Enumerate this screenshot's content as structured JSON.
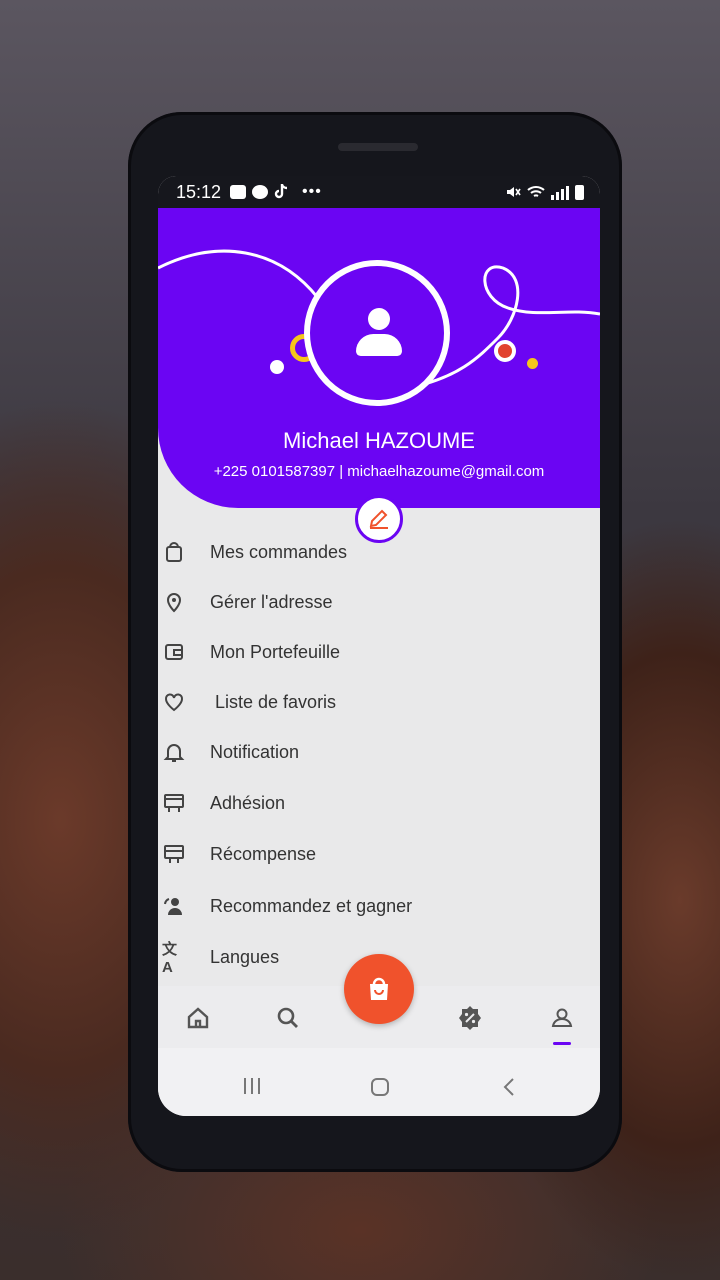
{
  "status_bar": {
    "time": "15:12",
    "icons": [
      "youtube-icon",
      "facebook-icon",
      "tiktok-icon",
      "more-icon"
    ],
    "right_icons": [
      "mute-icon",
      "wifi-icon",
      "signal-icon",
      "battery-icon"
    ]
  },
  "profile": {
    "name": "Michael HAZOUME",
    "contact": "+225 0101587397 | michaelhazoume@gmail.com",
    "avatar_icon": "user-icon",
    "edit_icon": "pencil-icon"
  },
  "menu": {
    "items": [
      {
        "label": "Mes commandes",
        "icon": "bag-icon"
      },
      {
        "label": "Gérer l'adresse",
        "icon": "location-pin-icon"
      },
      {
        "label": "Mon Portefeuille",
        "icon": "wallet-icon"
      },
      {
        "label": "Liste de favoris",
        "icon": "heart-icon"
      },
      {
        "label": "Notification",
        "icon": "bell-icon"
      },
      {
        "label": "Adhésion",
        "icon": "card-icon"
      },
      {
        "label": "Récompense",
        "icon": "reward-icon"
      },
      {
        "label": "Recommandez et gagner",
        "icon": "refer-icon"
      },
      {
        "label": "Langues",
        "icon": "translate-icon"
      }
    ]
  },
  "bottom_nav": {
    "items": [
      "home-icon",
      "search-icon",
      "shopping-bag-icon",
      "discount-icon",
      "profile-icon"
    ],
    "active": "profile-icon"
  },
  "system_nav": [
    "recents-icon",
    "home-button-icon",
    "back-icon"
  ],
  "colors": {
    "primary": "#6b05f3",
    "accent": "#f0522c",
    "text": "#333333"
  }
}
